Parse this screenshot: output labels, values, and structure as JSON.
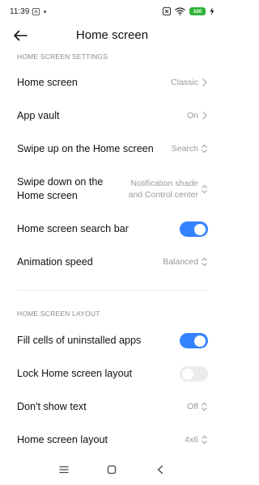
{
  "status_bar": {
    "time": "11:39",
    "battery": "100",
    "icons": [
      "notification-icon",
      "dot-icon",
      "close-box-icon",
      "wifi-icon",
      "battery-icon",
      "charging-icon"
    ]
  },
  "header": {
    "title": "Home screen",
    "back_icon": "back-arrow-icon"
  },
  "sections": {
    "settings_title": "HOME SCREEN SETTINGS",
    "layout_title": "HOME SCREEN LAYOUT"
  },
  "rows": {
    "home_screen": {
      "label": "Home screen",
      "value": "Classic",
      "icon": "chevron-right-icon"
    },
    "app_vault": {
      "label": "App vault",
      "value": "On",
      "icon": "chevron-right-icon"
    },
    "swipe_up": {
      "label": "Swipe up on the Home screen",
      "value": "Search",
      "icon": "chevron-updown-icon"
    },
    "swipe_down": {
      "label_line1": "Swipe down on the",
      "label_line2": "Home screen",
      "value_line1": "Notification shade",
      "value_line2": "and Control center",
      "icon": "chevron-updown-icon"
    },
    "search_bar": {
      "label": "Home screen search bar",
      "state": "on"
    },
    "animation_speed": {
      "label": "Animation speed",
      "value": "Balanced",
      "icon": "chevron-updown-icon"
    },
    "fill_cells": {
      "label": "Fill cells of uninstalled apps",
      "state": "on"
    },
    "lock_layout": {
      "label": "Lock Home screen layout",
      "state": "off"
    },
    "dont_show_text": {
      "label": "Don't show text",
      "value": "Off",
      "icon": "chevron-updown-icon"
    },
    "layout": {
      "label": "Home screen layout",
      "value": "4x6",
      "icon": "chevron-updown-icon"
    }
  },
  "colors": {
    "accent": "#3482ff",
    "toggle_off": "#ebebeb",
    "secondary_text": "#9a9a9a",
    "section_text": "#8a8a8a",
    "battery": "#2fb43a"
  },
  "nav_bar": {
    "icons": [
      "menu-icon",
      "home-square-icon",
      "back-triangle-icon"
    ]
  }
}
